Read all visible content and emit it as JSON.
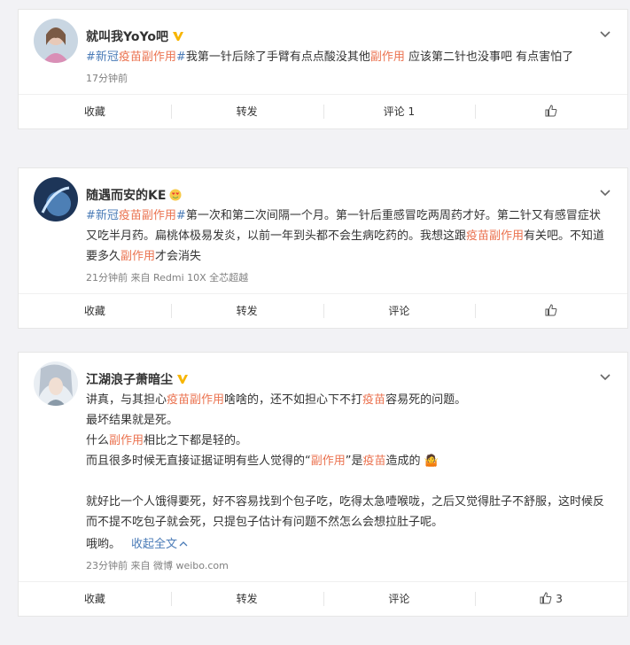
{
  "posts": [
    {
      "author": "就叫我YoYo吧",
      "badge": "gold-v-badge",
      "segments": [
        {
          "t": "#新冠",
          "c": "topic"
        },
        {
          "t": "疫苗副作用",
          "c": "tag"
        },
        {
          "t": "#",
          "c": "topic"
        },
        {
          "t": "我第一针后除了手臂有点点酸没其他",
          "c": ""
        },
        {
          "t": "副作用",
          "c": "tag"
        },
        {
          "t": " 应该第二针也没事吧 有点害怕了",
          "c": ""
        }
      ],
      "meta": "17分钟前",
      "actions": {
        "collect": "收藏",
        "repost": "转发",
        "comment": "评论 1",
        "like": ""
      }
    },
    {
      "author": "随遇而安的KE",
      "badge": "heart-eyes-emoji",
      "segments": [
        {
          "t": "#新冠",
          "c": "topic"
        },
        {
          "t": "疫苗副作用",
          "c": "tag"
        },
        {
          "t": "#",
          "c": "topic"
        },
        {
          "t": "第一次和第二次间隔一个月。第一针后重感冒吃两周药才好。第二针又有感冒症状又吃半月药。扁桃体极易发炎，以前一年到头都不会生病吃药的。我想这跟",
          "c": ""
        },
        {
          "t": "疫苗副作用",
          "c": "tag"
        },
        {
          "t": "有关吧。不知道要多久",
          "c": ""
        },
        {
          "t": "副作用",
          "c": "tag"
        },
        {
          "t": "才会消失",
          "c": ""
        }
      ],
      "meta": "21分钟前  来自 Redmi 10X 全芯超越",
      "actions": {
        "collect": "收藏",
        "repost": "转发",
        "comment": "评论",
        "like": ""
      }
    },
    {
      "author": "江湖浪子萧暗尘",
      "badge": "gold-v-badge",
      "paragraphs": [
        [
          {
            "t": "讲真，与其担心",
            "c": ""
          },
          {
            "t": "疫苗副作用",
            "c": "tag"
          },
          {
            "t": "啥啥的，还不如担心下不打",
            "c": ""
          },
          {
            "t": "疫苗",
            "c": "tag"
          },
          {
            "t": "容易死的问题。",
            "c": ""
          }
        ],
        [
          {
            "t": "最坏结果就是死。",
            "c": ""
          }
        ],
        [
          {
            "t": "什么",
            "c": ""
          },
          {
            "t": "副作用",
            "c": "tag"
          },
          {
            "t": "相比之下都是轻的。",
            "c": ""
          }
        ],
        [
          {
            "t": "而且很多时候无直接证据证明有些人觉得的“",
            "c": ""
          },
          {
            "t": "副作用",
            "c": "tag"
          },
          {
            "t": "”是",
            "c": ""
          },
          {
            "t": "疫苗",
            "c": "tag"
          },
          {
            "t": "造成的 🤷",
            "c": ""
          }
        ],
        [
          {
            "t": "",
            "c": ""
          }
        ],
        [
          {
            "t": "就好比一个人饿得要死，好不容易找到个包子吃，吃得太急噎喉咙，之后又觉得肚子不舒服，这时候反而不提不吃包子就会死，只提包子估计有问题不然怎么会想拉肚子呢。",
            "c": ""
          }
        ]
      ],
      "tail": "哦哟。",
      "collapse": "收起全文",
      "meta": "23分钟前  来自 微博 weibo.com",
      "actions": {
        "collect": "收藏",
        "repost": "转发",
        "comment": "评论",
        "like": "3"
      }
    }
  ]
}
